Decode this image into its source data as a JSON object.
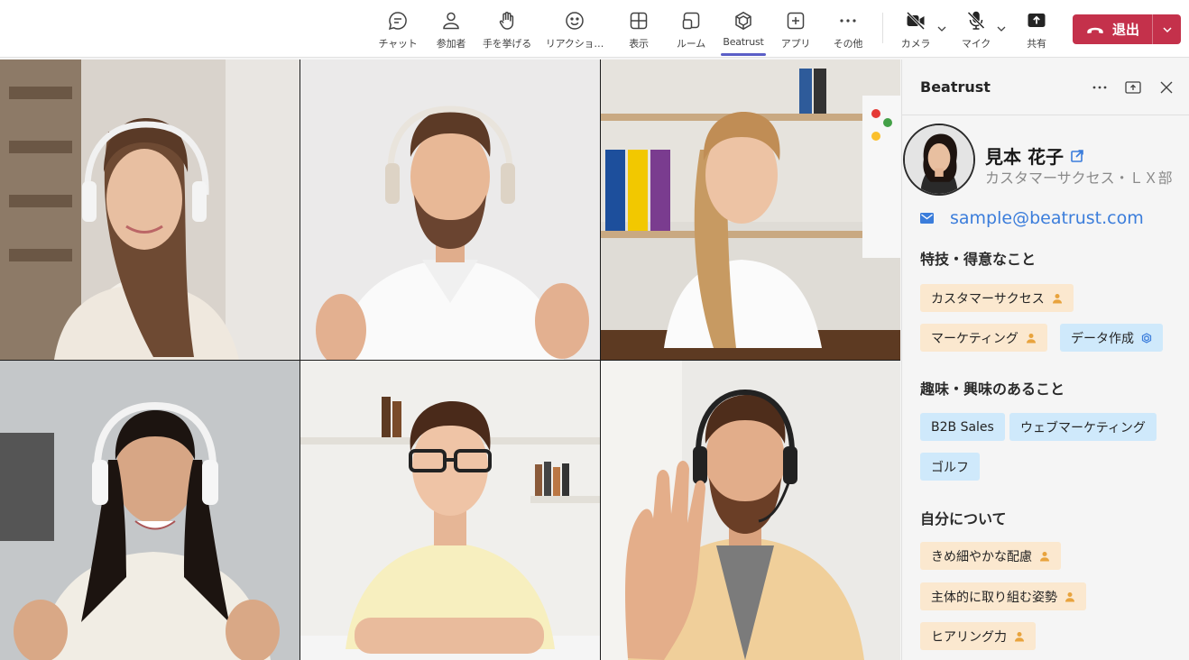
{
  "toolbar": {
    "items": [
      {
        "label": "チャット",
        "icon": "chat-icon"
      },
      {
        "label": "参加者",
        "icon": "people-icon"
      },
      {
        "label": "手を挙げる",
        "icon": "raise-hand-icon"
      },
      {
        "label": "リアクショ…",
        "icon": "emoji-icon"
      },
      {
        "label": "表示",
        "icon": "view-grid-icon"
      },
      {
        "label": "ルーム",
        "icon": "rooms-icon"
      },
      {
        "label": "Beatrust",
        "icon": "beatrust-icon"
      },
      {
        "label": "アプリ",
        "icon": "apps-icon"
      },
      {
        "label": "その他",
        "icon": "more-icon"
      },
      {
        "label": "カメラ",
        "icon": "camera-off-icon"
      },
      {
        "label": "マイク",
        "icon": "mic-off-icon"
      },
      {
        "label": "共有",
        "icon": "share-icon"
      }
    ],
    "leave_label": "退出",
    "colors": {
      "leave": "#c4314b",
      "active_underline": "#5b5fc7"
    }
  },
  "panel": {
    "title": "Beatrust",
    "profile": {
      "name": "見本 花子",
      "role": "カスタマーサクセス・ＬＸ部",
      "email": "sample@beatrust.com"
    },
    "sections": [
      {
        "title": "特技・得意なこと",
        "chips": [
          {
            "label": "カスタマーサクセス",
            "style": "peach",
            "icon": "person-icon"
          },
          {
            "label": "マーケティング",
            "style": "peach",
            "icon": "person-icon"
          },
          {
            "label": "データ作成",
            "style": "blue",
            "icon": "beatrust-icon"
          }
        ]
      },
      {
        "title": "趣味・興味のあること",
        "chips": [
          {
            "label": "B2B Sales",
            "style": "blue"
          },
          {
            "label": "ウェブマーケティング",
            "style": "blue"
          },
          {
            "label": "ゴルフ",
            "style": "blue"
          }
        ]
      },
      {
        "title": "自分について",
        "chips": [
          {
            "label": "きめ細やかな配慮",
            "style": "peach",
            "icon": "person-icon"
          },
          {
            "label": "主体的に取り組む姿勢",
            "style": "peach",
            "icon": "person-icon"
          },
          {
            "label": "ヒアリング力",
            "style": "peach",
            "icon": "person-icon"
          }
        ]
      }
    ],
    "colors": {
      "chip_peach": "#fbe8cf",
      "chip_blue": "#cfe9fb",
      "link": "#3b7ddb",
      "person_icon": "#e8a33d"
    }
  }
}
